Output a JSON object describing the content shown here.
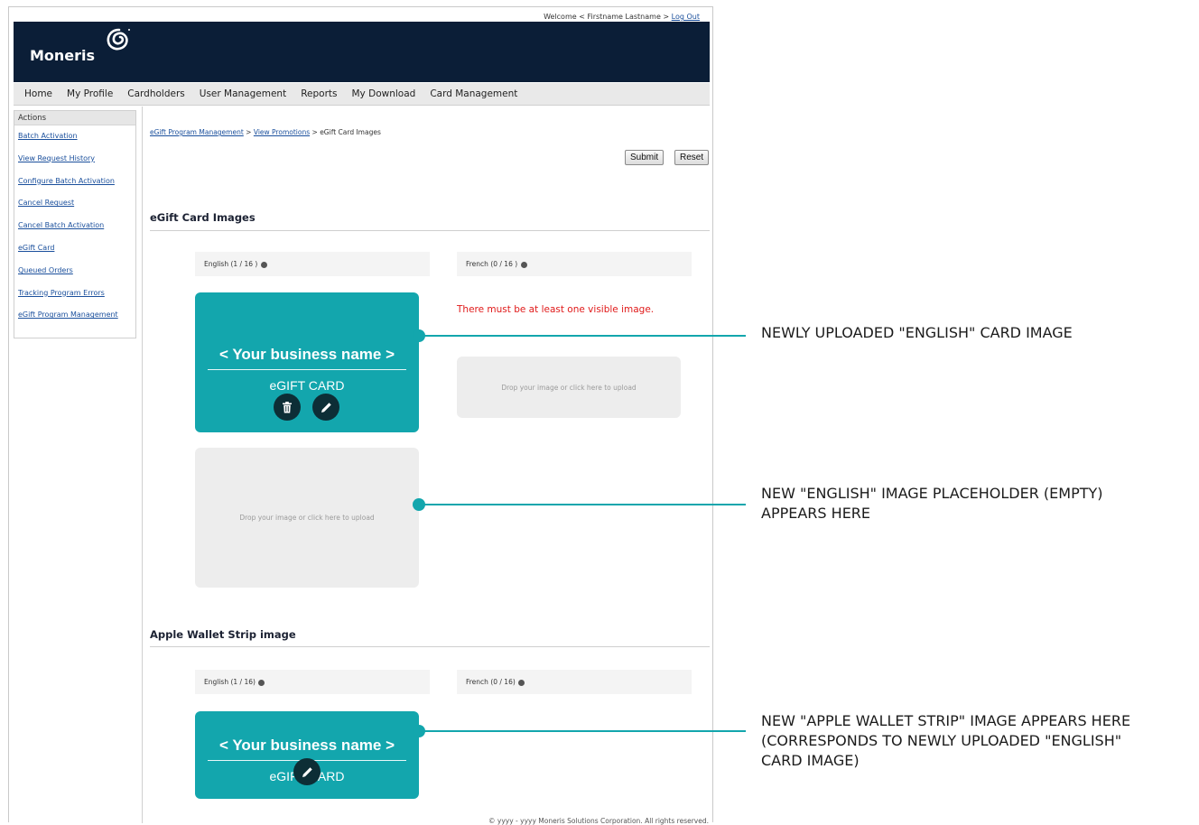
{
  "header": {
    "welcome_text": "Welcome < Firstname Lastname >",
    "logout_label": "Log Out",
    "brand_name": "Moneris"
  },
  "nav": {
    "items": [
      "Home",
      "My Profile",
      "Cardholders",
      "User Management",
      "Reports",
      "My Download",
      "Card Management"
    ]
  },
  "sidebar": {
    "heading": "Actions",
    "items": [
      "Batch Activation",
      "View Request History",
      "Configure Batch Activation",
      "Cancel Request",
      "Cancel Batch Activation",
      "eGift Card",
      "Queued Orders",
      "Tracking Program Errors",
      "eGift Program Management"
    ]
  },
  "breadcrumb": {
    "link1": "eGift Program Management",
    "sep": ">",
    "link2": "View Promotions",
    "current": "eGift Card Images"
  },
  "actions": {
    "submit_label": "Submit",
    "reset_label": "Reset"
  },
  "egift_section": {
    "title": "eGift Card Images",
    "english_label": "English (1 / 16 )",
    "french_label": "French (0 / 16 )",
    "card_title": "< Your business name >",
    "card_sub": "eGIFT CARD",
    "error": "There must be at least one visible image.",
    "drop_text": "Drop your image or click here to upload"
  },
  "wallet_section": {
    "title": "Apple Wallet Strip image",
    "english_label": "English (1 / 16)",
    "french_label": "French (0 / 16)",
    "card_title": "< Your business name >",
    "card_sub": "eGIFT CARD"
  },
  "footer": {
    "text": "© yyyy - yyyy   Moneris Solutions Corporation. All rights reserved."
  },
  "callouts": {
    "one": "NEWLY UPLOADED \"ENGLISH\" CARD IMAGE",
    "two": "NEW \"ENGLISH\" IMAGE PLACEHOLDER (EMPTY)  APPEARS HERE",
    "three": "NEW \"APPLE WALLET STRIP\" IMAGE APPEARS HERE (CORRESPONDS TO NEWLY UPLOADED \"ENGLISH\" CARD IMAGE)"
  },
  "colors": {
    "brand_bar": "#0b1e37",
    "accent_teal": "#13a6ad",
    "error_red": "#e01a1a",
    "link_blue": "#1a4f9c"
  },
  "icons": [
    "moneris-swirl-icon",
    "info-icon",
    "trash-icon",
    "pencil-icon"
  ]
}
